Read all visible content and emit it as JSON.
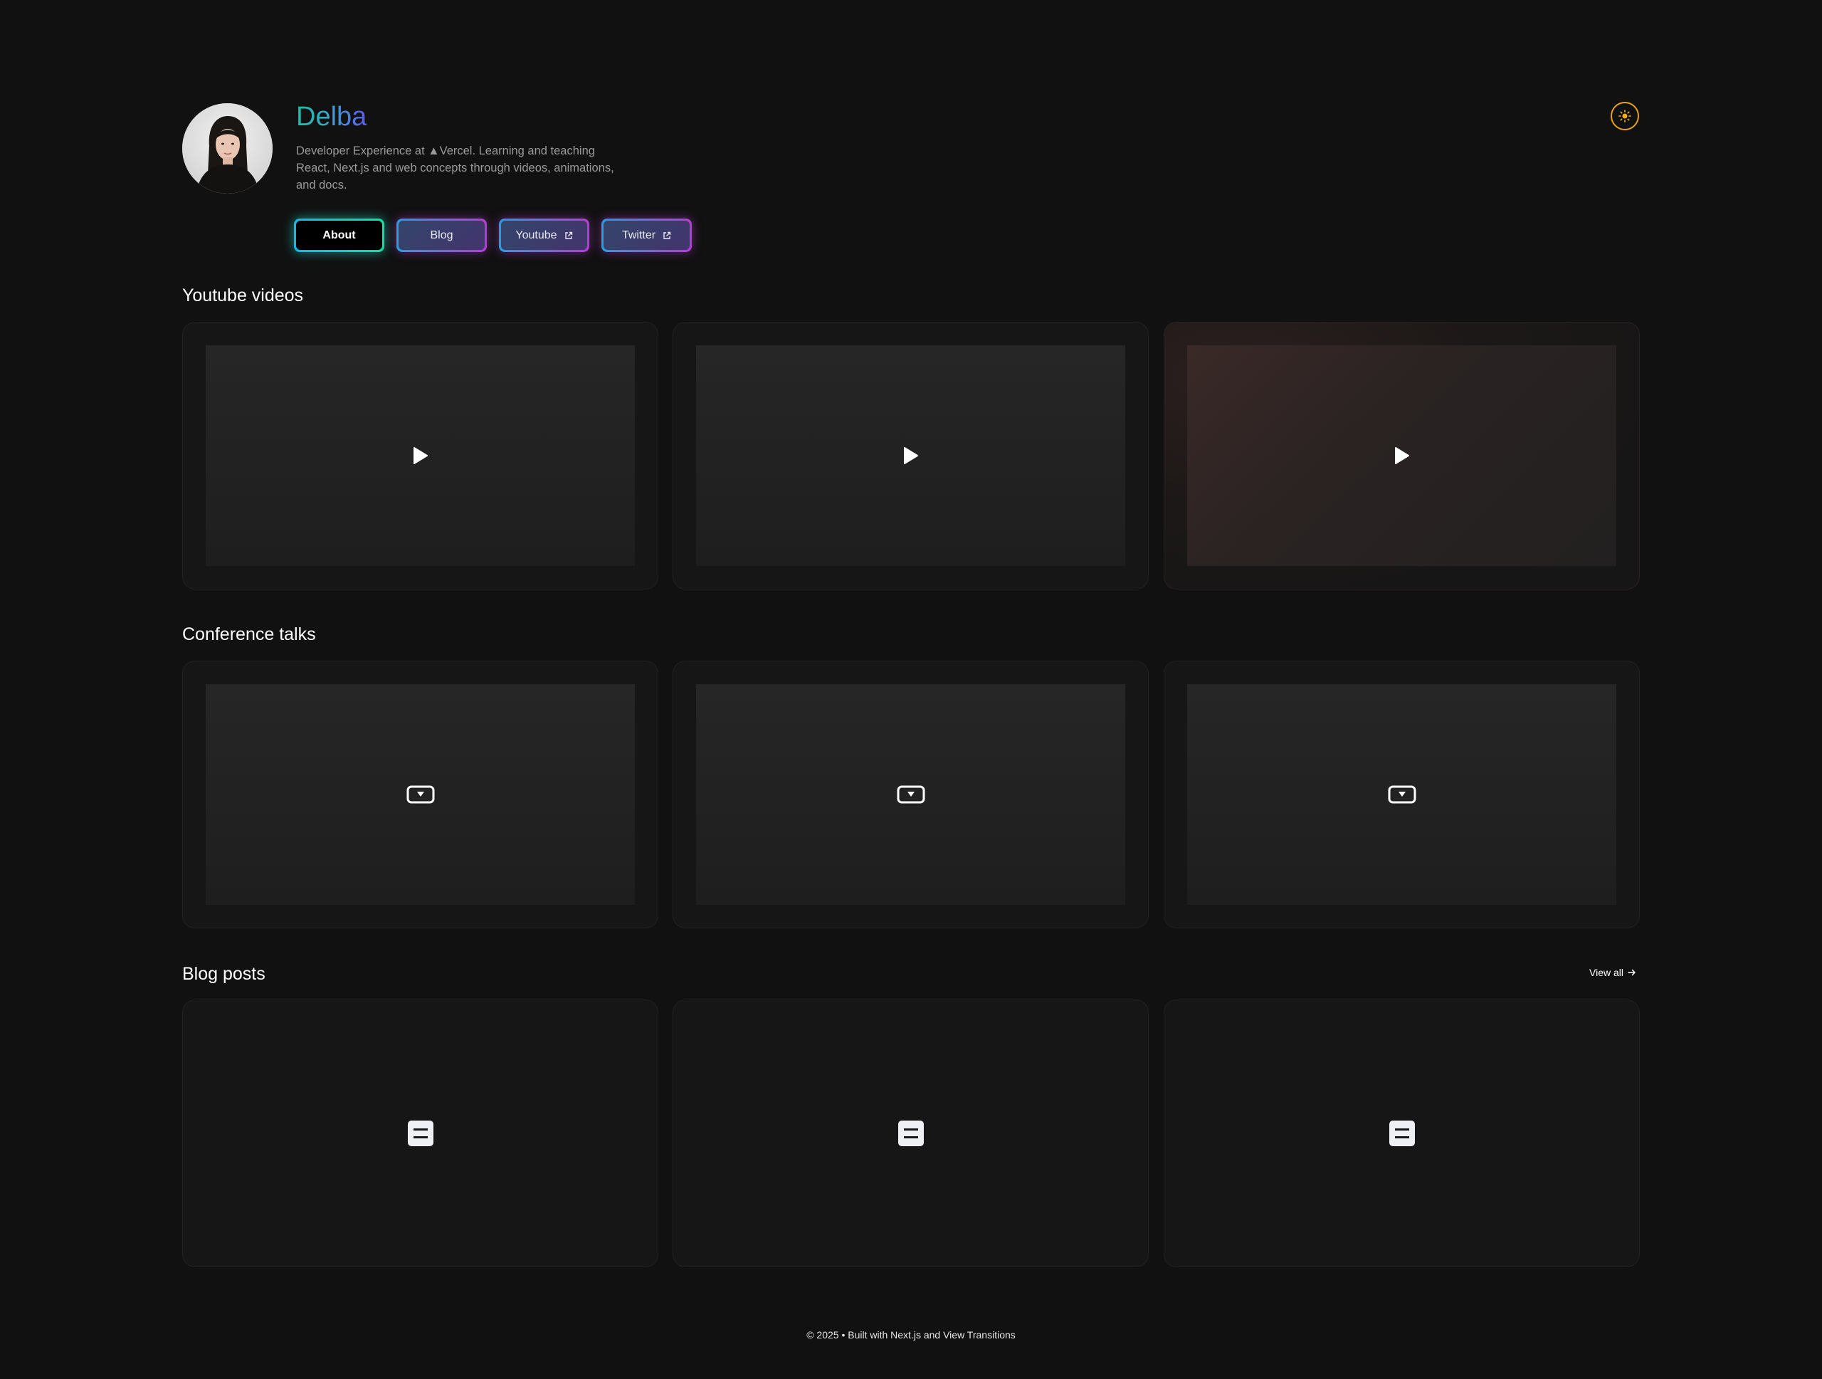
{
  "profile": {
    "name": "Delba",
    "bio": "Developer Experience at ▲Vercel. Learning and teaching React, Next.js and web concepts through videos, animations, and docs."
  },
  "nav": [
    {
      "label": "About",
      "active": true,
      "external": false
    },
    {
      "label": "Blog",
      "active": false,
      "external": false
    },
    {
      "label": "Youtube",
      "active": false,
      "external": true
    },
    {
      "label": "Twitter",
      "active": false,
      "external": true
    }
  ],
  "theme_toggle": {
    "icon": "sun-icon",
    "color": "#e8a21a"
  },
  "sections": {
    "youtube": {
      "title": "Youtube videos",
      "icon": "play-icon",
      "count": 3
    },
    "talks": {
      "title": "Conference talks",
      "icon": "presentation-icon",
      "count": 3
    },
    "blog": {
      "title": "Blog posts",
      "icon": "document-icon",
      "count": 3,
      "view_all": "View all"
    }
  },
  "footer": {
    "text": "© 2025 • Built with Next.js and View Transitions"
  },
  "colors": {
    "background": "#111111",
    "card": "#161616",
    "accent_cyan": "#12e0a0",
    "accent_purple": "#b43cd6",
    "name_gradient_start": "#16c0a4",
    "name_gradient_end": "#5b5cf0"
  }
}
